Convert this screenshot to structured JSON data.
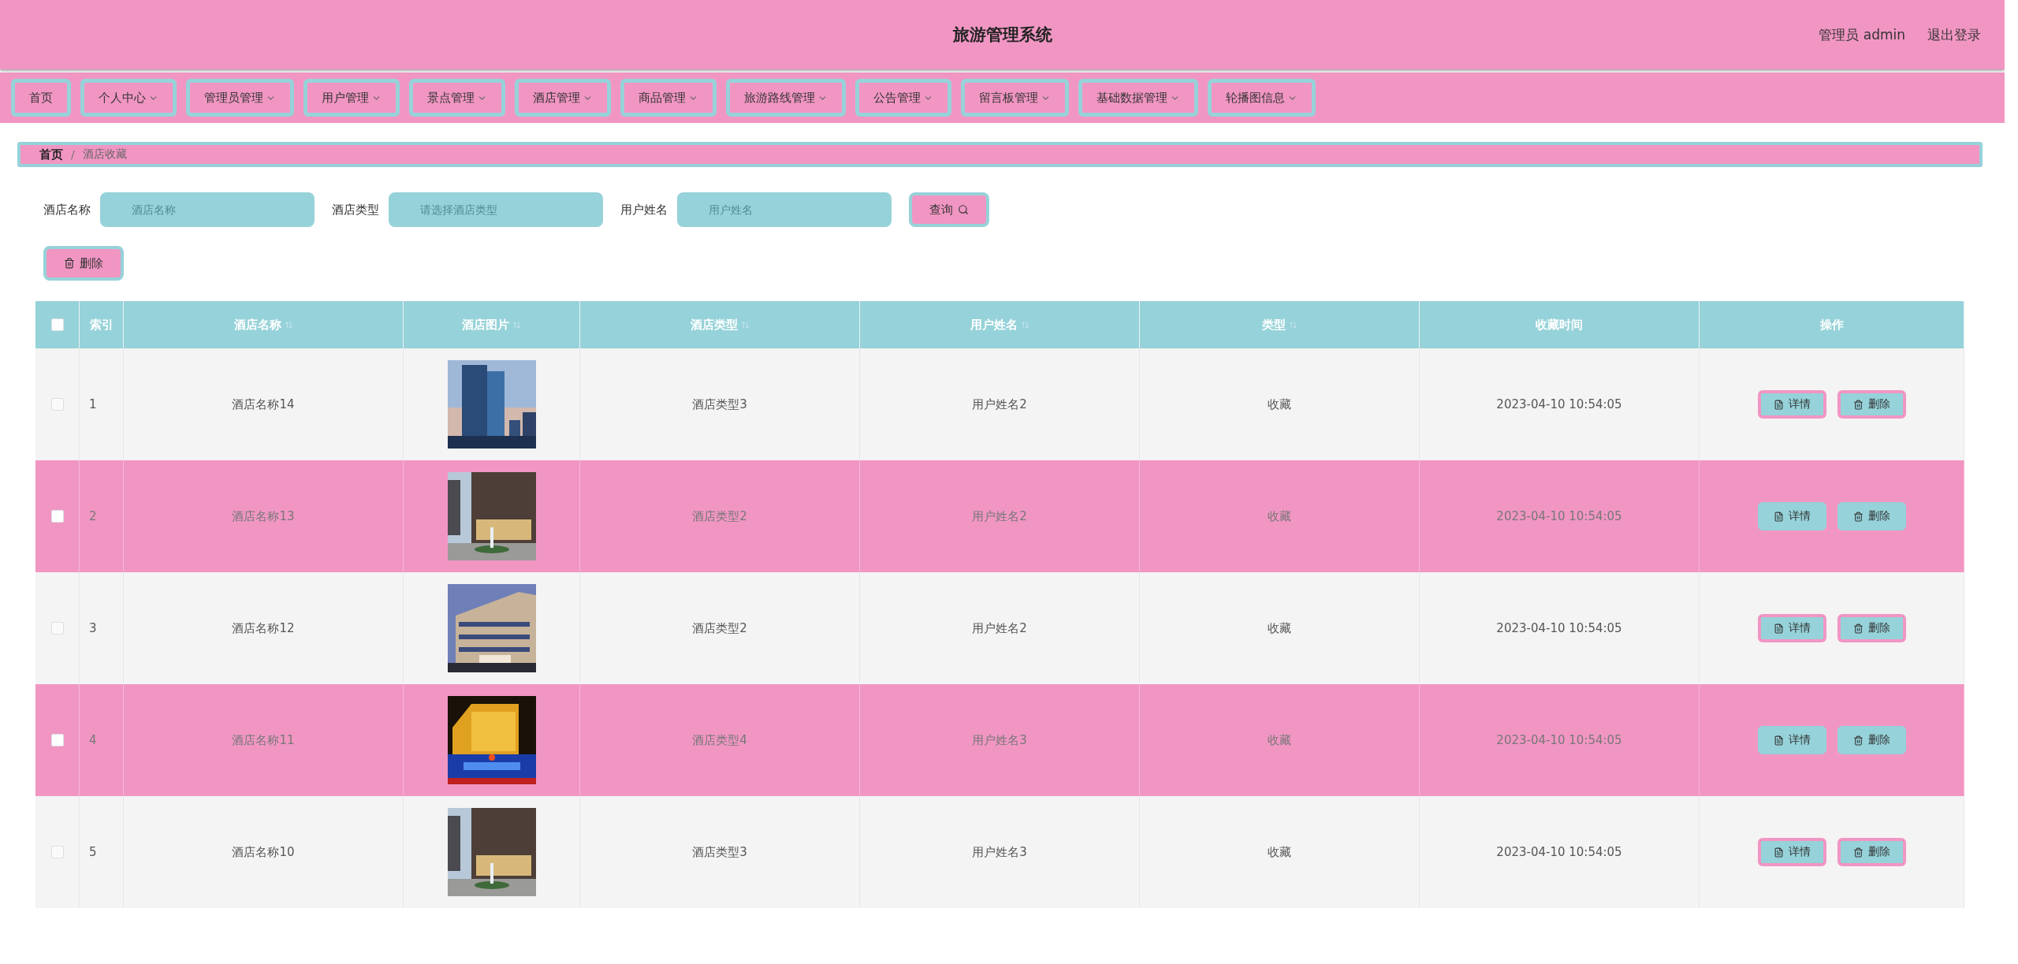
{
  "header": {
    "title": "旅游管理系统",
    "user": "管理员 admin",
    "logout": "退出登录"
  },
  "nav": [
    {
      "label": "首页",
      "dropdown": false
    },
    {
      "label": "个人中心",
      "dropdown": true
    },
    {
      "label": "管理员管理",
      "dropdown": true
    },
    {
      "label": "用户管理",
      "dropdown": true
    },
    {
      "label": "景点管理",
      "dropdown": true
    },
    {
      "label": "酒店管理",
      "dropdown": true
    },
    {
      "label": "商品管理",
      "dropdown": true
    },
    {
      "label": "旅游路线管理",
      "dropdown": true
    },
    {
      "label": "公告管理",
      "dropdown": true
    },
    {
      "label": "留言板管理",
      "dropdown": true
    },
    {
      "label": "基础数据管理",
      "dropdown": true
    },
    {
      "label": "轮播图信息",
      "dropdown": true
    }
  ],
  "breadcrumb": {
    "items": [
      "首页",
      "酒店收藏"
    ],
    "separator": "/"
  },
  "search": {
    "fields": [
      {
        "label": "酒店名称",
        "placeholder": "酒店名称"
      },
      {
        "label": "酒店类型",
        "placeholder": "请选择酒店类型"
      },
      {
        "label": "用户姓名",
        "placeholder": "用户姓名"
      }
    ],
    "button": "查询"
  },
  "toolbar": {
    "delete": "删除"
  },
  "table": {
    "all_checked": false,
    "columns": [
      {
        "label": "索引",
        "sortable": false
      },
      {
        "label": "酒店名称",
        "sortable": true
      },
      {
        "label": "酒店图片",
        "sortable": true
      },
      {
        "label": "酒店类型",
        "sortable": true
      },
      {
        "label": "用户姓名",
        "sortable": true
      },
      {
        "label": "类型",
        "sortable": true
      },
      {
        "label": "收藏时间",
        "sortable": false
      },
      {
        "label": "操作",
        "sortable": false
      }
    ],
    "rows": [
      {
        "checked": false,
        "index": "1",
        "name": "酒店名称14",
        "picture": {
          "kind": "picture"
        },
        "type": "酒店类型3",
        "user": "用户姓名2",
        "kind": "收藏",
        "time": "2023-04-10 10:54:05",
        "actions": [
          "详情",
          "删除"
        ]
      },
      {
        "checked": false,
        "index": "2",
        "name": "酒店名称13",
        "picture": {
          "kind": "picture"
        },
        "type": "酒店类型2",
        "user": "用户姓名2",
        "kind": "收藏",
        "time": "2023-04-10 10:54:05",
        "actions": [
          "详情",
          "删除"
        ]
      },
      {
        "checked": false,
        "index": "3",
        "name": "酒店名称12",
        "picture": {
          "kind": "picture"
        },
        "type": "酒店类型2",
        "user": "用户姓名2",
        "kind": "收藏",
        "time": "2023-04-10 10:54:05",
        "actions": [
          "详情",
          "删除"
        ]
      },
      {
        "checked": false,
        "index": "4",
        "name": "酒店名称11",
        "picture": {
          "kind": "picture"
        },
        "type": "酒店类型4",
        "user": "用户姓名3",
        "kind": "收藏",
        "time": "2023-04-10 10:54:05",
        "actions": [
          "详情",
          "删除"
        ]
      },
      {
        "checked": false,
        "index": "5",
        "name": "酒店名称10",
        "picture": {
          "kind": "picture"
        },
        "type": "酒店类型3",
        "user": "用户姓名3",
        "kind": "收藏",
        "time": "2023-04-10 10:54:05",
        "actions": [
          "详情",
          "删除"
        ]
      }
    ]
  }
}
